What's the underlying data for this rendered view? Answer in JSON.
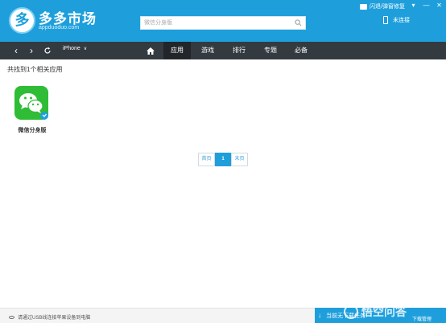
{
  "header": {
    "brand_name": "多多市场",
    "brand_domain": "appduoduo.com",
    "search": {
      "placeholder": "微信分身版"
    },
    "top_right": {
      "flash_label": "闪退/弹窗修复"
    },
    "window_controls": {
      "menu": "▾",
      "minimize": "—",
      "close": "✕"
    },
    "device_status": "未连接"
  },
  "navbar": {
    "device_selector": "iPhone",
    "tabs": [
      {
        "label": "应用",
        "active": true
      },
      {
        "label": "游戏",
        "active": false
      },
      {
        "label": "排行",
        "active": false
      },
      {
        "label": "专题",
        "active": false
      },
      {
        "label": "必备",
        "active": false
      }
    ]
  },
  "main": {
    "result_count": "共找到1个相关应用",
    "apps": [
      {
        "name": "微信分身版",
        "icon": "wechat-icon",
        "icon_color": "#2fbd35"
      }
    ],
    "pagination": {
      "first": "首页",
      "current": "1",
      "last": "末页"
    }
  },
  "footer": {
    "hint": "请通过USB线连接苹果设备到电脑",
    "download_status": "当前无下载任务",
    "download_manage": "下载管理",
    "watermark": "悟空问答"
  },
  "colors": {
    "primary": "#1e9fdc",
    "nav_background": "#333a40",
    "active_tab": "#22262a",
    "wechat_green": "#2fbd35"
  }
}
